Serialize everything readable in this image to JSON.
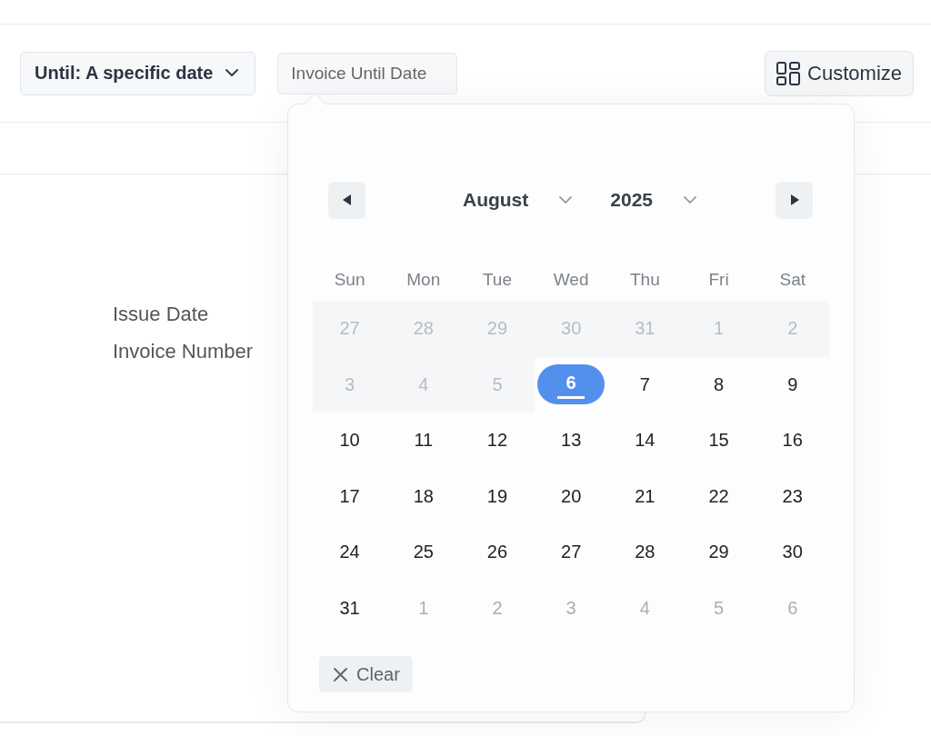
{
  "toolbar": {
    "until_filter": "Until: A specific date",
    "date_field": {
      "placeholder": "Invoice Until Date"
    },
    "customize_button": "Customize"
  },
  "fields": [
    "Issue Date",
    "Invoice Number"
  ],
  "datepicker": {
    "month": "August",
    "year": "2025",
    "weekdays": [
      "Sun",
      "Mon",
      "Tue",
      "Wed",
      "Thu",
      "Fri",
      "Sat"
    ],
    "days": [
      {
        "label": "27",
        "kind": "past",
        "selected": false
      },
      {
        "label": "28",
        "kind": "past",
        "selected": false
      },
      {
        "label": "29",
        "kind": "past",
        "selected": false
      },
      {
        "label": "30",
        "kind": "past",
        "selected": false
      },
      {
        "label": "31",
        "kind": "past",
        "selected": false
      },
      {
        "label": "1",
        "kind": "past",
        "selected": false
      },
      {
        "label": "2",
        "kind": "past",
        "selected": false
      },
      {
        "label": "3",
        "kind": "past",
        "selected": false
      },
      {
        "label": "4",
        "kind": "past",
        "selected": false
      },
      {
        "label": "5",
        "kind": "past",
        "selected": false
      },
      {
        "label": "6",
        "kind": "today",
        "selected": true
      },
      {
        "label": "7",
        "kind": "current",
        "selected": false
      },
      {
        "label": "8",
        "kind": "current",
        "selected": false
      },
      {
        "label": "9",
        "kind": "current",
        "selected": false
      },
      {
        "label": "10",
        "kind": "current",
        "selected": false
      },
      {
        "label": "11",
        "kind": "current",
        "selected": false
      },
      {
        "label": "12",
        "kind": "current",
        "selected": false
      },
      {
        "label": "13",
        "kind": "current",
        "selected": false
      },
      {
        "label": "14",
        "kind": "current",
        "selected": false
      },
      {
        "label": "15",
        "kind": "current",
        "selected": false
      },
      {
        "label": "16",
        "kind": "current",
        "selected": false
      },
      {
        "label": "17",
        "kind": "current",
        "selected": false
      },
      {
        "label": "18",
        "kind": "current",
        "selected": false
      },
      {
        "label": "19",
        "kind": "current",
        "selected": false
      },
      {
        "label": "20",
        "kind": "current",
        "selected": false
      },
      {
        "label": "21",
        "kind": "current",
        "selected": false
      },
      {
        "label": "22",
        "kind": "current",
        "selected": false
      },
      {
        "label": "23",
        "kind": "current",
        "selected": false
      },
      {
        "label": "24",
        "kind": "current",
        "selected": false
      },
      {
        "label": "25",
        "kind": "current",
        "selected": false
      },
      {
        "label": "26",
        "kind": "current",
        "selected": false
      },
      {
        "label": "27",
        "kind": "current",
        "selected": false
      },
      {
        "label": "28",
        "kind": "current",
        "selected": false
      },
      {
        "label": "29",
        "kind": "current",
        "selected": false
      },
      {
        "label": "30",
        "kind": "current",
        "selected": false
      },
      {
        "label": "31",
        "kind": "current",
        "selected": false
      },
      {
        "label": "1",
        "kind": "next",
        "selected": false
      },
      {
        "label": "2",
        "kind": "next",
        "selected": false
      },
      {
        "label": "3",
        "kind": "next",
        "selected": false
      },
      {
        "label": "4",
        "kind": "next",
        "selected": false
      },
      {
        "label": "5",
        "kind": "next",
        "selected": false
      },
      {
        "label": "6",
        "kind": "next",
        "selected": false
      }
    ],
    "clear_button": "Clear"
  }
}
